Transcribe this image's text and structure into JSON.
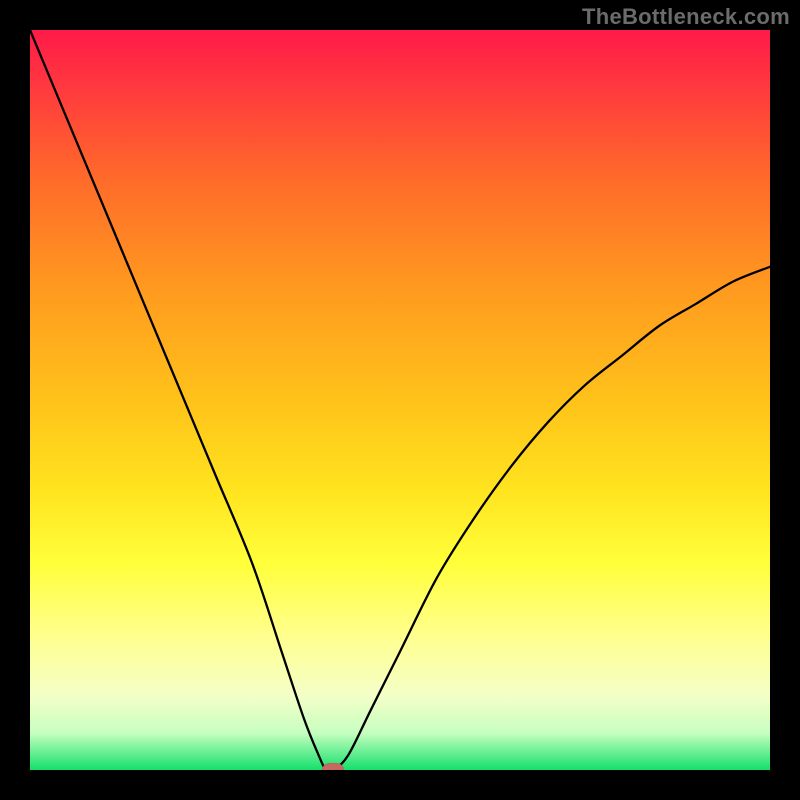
{
  "watermark": "TheBottleneck.com",
  "chart_data": {
    "type": "line",
    "title": "",
    "xlabel": "",
    "ylabel": "",
    "xlim": [
      0,
      100
    ],
    "ylim": [
      0,
      100
    ],
    "grid": false,
    "legend": false,
    "series": [
      {
        "name": "bottleneck-curve",
        "x": [
          0,
          5,
          10,
          15,
          20,
          25,
          30,
          34,
          37,
          39,
          40,
          41,
          43,
          46,
          50,
          55,
          60,
          65,
          70,
          75,
          80,
          85,
          90,
          95,
          100
        ],
        "values": [
          100,
          88,
          76,
          64,
          52,
          40,
          28,
          16,
          7,
          2,
          0,
          0,
          2,
          8,
          16,
          26,
          34,
          41,
          47,
          52,
          56,
          60,
          63,
          66,
          68
        ]
      }
    ],
    "marker": {
      "x": 41,
      "y": 0,
      "color": "#c46a62"
    },
    "background_gradient": {
      "direction": "top-to-bottom",
      "stops": [
        {
          "pos": 0.0,
          "color": "#ff1a49"
        },
        {
          "pos": 0.5,
          "color": "#ffc21a"
        },
        {
          "pos": 0.72,
          "color": "#ffff3a"
        },
        {
          "pos": 1.0,
          "color": "#14e06b"
        }
      ]
    }
  },
  "colors": {
    "frame": "#000000",
    "curve_stroke": "#000000",
    "marker": "#c46a62",
    "watermark": "#6b6b6b"
  }
}
